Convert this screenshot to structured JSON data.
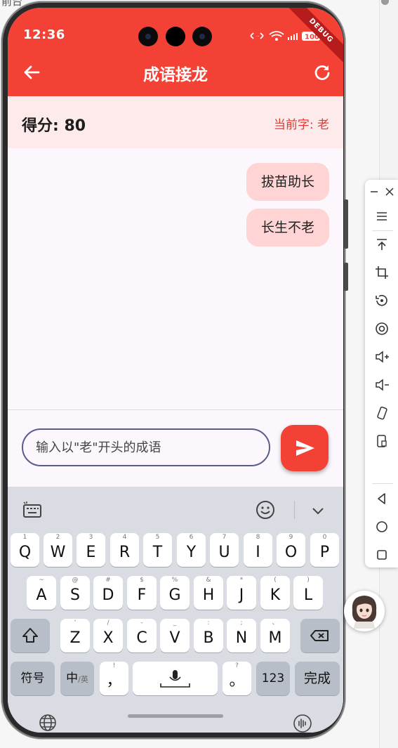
{
  "page": {
    "top_text": "前台"
  },
  "status_bar": {
    "time": "12:36",
    "battery": "100",
    "debug_label": "DEBUG"
  },
  "app_bar": {
    "title": "成语接龙",
    "back_icon": "arrow-left-icon",
    "refresh_icon": "refresh-icon"
  },
  "score_bar": {
    "score_text": "得分: 80",
    "current_char_text": "当前字: 老"
  },
  "chat": {
    "messages": [
      "拔苗助长",
      "长生不老"
    ]
  },
  "input": {
    "placeholder": "输入以\"老\"开头的成语",
    "value": "",
    "send_icon": "send-icon"
  },
  "keyboard": {
    "toolbar": {
      "left_icon": "keyboard-settings-icon",
      "emoji_icon": "emoji-icon",
      "collapse_icon": "chevron-down-icon"
    },
    "row1": [
      {
        "main": "Q",
        "hint": "1"
      },
      {
        "main": "W",
        "hint": "2"
      },
      {
        "main": "E",
        "hint": "3"
      },
      {
        "main": "R",
        "hint": "4"
      },
      {
        "main": "T",
        "hint": "5"
      },
      {
        "main": "Y",
        "hint": "6"
      },
      {
        "main": "U",
        "hint": "7"
      },
      {
        "main": "I",
        "hint": "8"
      },
      {
        "main": "O",
        "hint": "9"
      },
      {
        "main": "P",
        "hint": "0"
      }
    ],
    "row2": [
      {
        "main": "A",
        "hint": "~"
      },
      {
        "main": "S",
        "hint": "@"
      },
      {
        "main": "D",
        "hint": "#"
      },
      {
        "main": "F",
        "hint": "$"
      },
      {
        "main": "G",
        "hint": "%"
      },
      {
        "main": "H",
        "hint": "&"
      },
      {
        "main": "J",
        "hint": "*"
      },
      {
        "main": "K",
        "hint": "("
      },
      {
        "main": "L",
        "hint": ")"
      }
    ],
    "row3": [
      {
        "main": "Z",
        "hint": "'"
      },
      {
        "main": "X",
        "hint": "/"
      },
      {
        "main": "C",
        "hint": "-"
      },
      {
        "main": "V",
        "hint": "_"
      },
      {
        "main": "B",
        "hint": ":"
      },
      {
        "main": "N",
        "hint": ";"
      },
      {
        "main": "M",
        "hint": "、"
      }
    ],
    "row4": {
      "symbols": "符号",
      "lang_main": "中",
      "lang_alt": "/英",
      "comma": "，",
      "comma_hint": "!",
      "period": "。",
      "period_hint": "?",
      "numbers": "123",
      "done": "完成"
    },
    "bottom": {
      "globe_icon": "globe-icon",
      "voice_icon": "voice-wave-icon"
    }
  },
  "floating_panel": {
    "icons": [
      "minimize-icon",
      "close-icon",
      "menu-icon",
      "pin-top-icon",
      "crop-icon",
      "rotate-icon",
      "record-icon",
      "volume-up-icon",
      "volume-down-icon",
      "shake-icon",
      "screenshot-icon",
      "back-icon",
      "home-icon",
      "recents-icon"
    ]
  },
  "colors": {
    "primary": "#f34235",
    "bubble": "#ffd4d4",
    "score_bg": "#fdeaea",
    "accent_text": "#e53935"
  }
}
